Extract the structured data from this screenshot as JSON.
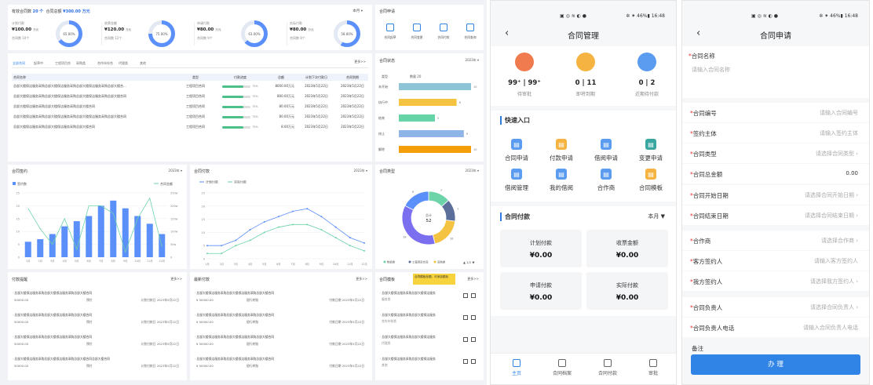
{
  "dashboard": {
    "summary": {
      "count_label": "有效合同数",
      "count_value": "20 个",
      "amount_label": "合同总额",
      "amount_value": "¥300.00 万元",
      "period": "本月",
      "kpis": [
        {
          "title": "计划付款",
          "value": "¥100.00",
          "unit": "万元",
          "sub": "合同数 10个",
          "pct": "65.00%",
          "pctnum": 65,
          "color": "#5b8ff9"
        },
        {
          "title": "收票金额",
          "value": "¥120.00",
          "unit": "万元",
          "sub": "合同数 12个",
          "pct": "75.00%",
          "pctnum": 75,
          "color": "#5b8ff9"
        },
        {
          "title": "申请付款",
          "value": "¥80.00",
          "unit": "万元",
          "sub": "合同数 9个",
          "pct": "63.00%",
          "pctnum": 63,
          "color": "#5b8ff9"
        },
        {
          "title": "实际付款",
          "value": "¥80.00",
          "unit": "万元",
          "sub": "合同数 8个",
          "pct": "58.00%",
          "pctnum": 58,
          "color": "#5b8ff9"
        }
      ]
    },
    "apply": {
      "title": "合同申请",
      "items": [
        "合同起草",
        "合同变更",
        "合同付款",
        "合同查询"
      ]
    },
    "contract_table": {
      "tabs": [
        "全部合同",
        "起草中",
        "工程项目合",
        "采购类",
        "合作伙伴合",
        "代理类",
        "其他"
      ],
      "more": "更多>>",
      "headers": [
        "合同名称",
        "类型",
        "付款进度",
        "总额",
        "计划下次付款日",
        "合同到期"
      ],
      "rows": [
        {
          "name": "总部大楼保洁服务采购总部大楼保洁服务采购总部大楼保洁服务采购总部大楼合...",
          "type": "工程项目合同",
          "pct": "75%",
          "fill": 75,
          "total": "8000.00万元",
          "next": "2023年5月22日",
          "due": "2023年5月22日"
        },
        {
          "name": "总部大楼保洁服务采购总部大楼保洁服务采购总部大楼保洁服务采购总部大楼合同",
          "type": "工程项目合同",
          "pct": "75%",
          "fill": 75,
          "total": "800.00万元",
          "next": "2023年5月22日",
          "due": "2023年5月22日"
        },
        {
          "name": "总部大楼保洁服务采购总部大楼保洁服务采购总部大楼合同",
          "type": "工程项目合同",
          "pct": "75%",
          "fill": 75,
          "total": "80.00万元",
          "next": "2023年5月22日",
          "due": "2023年5月22日"
        },
        {
          "name": "总部大楼保洁服务采购总部大楼保洁服务采购总部大楼保洁服务采购总部大楼合同",
          "type": "工程项目合同",
          "pct": "75%",
          "fill": 75,
          "total": "80.00万元",
          "next": "2023年5月22日",
          "due": "2023年5月22日"
        },
        {
          "name": "总部大楼保洁服务采购总部大楼保洁服务采购总部大楼合同",
          "type": "工程项目合同",
          "pct": "75%",
          "fill": 75,
          "total": "8.00万元",
          "next": "2023年5月22日",
          "due": "2023年5月22日"
        }
      ]
    },
    "status": {
      "title": "合同状态",
      "year": "2023年",
      "col1": "类型",
      "col2": "数量 20",
      "chart_data": {
        "type": "bar",
        "orientation": "horizontal",
        "categories": [
          "未开始",
          "执行中",
          "结束",
          "终止",
          "解除"
        ],
        "values": [
          10,
          8,
          5,
          9,
          10
        ],
        "colors": [
          "#8ec5d6",
          "#f5c342",
          "#66d4a6",
          "#8fb5e8",
          "#f59e0b"
        ],
        "xlim": [
          0,
          10
        ]
      }
    },
    "sign": {
      "title": "合同签约",
      "year": "2023年",
      "legend_a": "签约数",
      "legend_b": "合同金额",
      "chart_data": {
        "type": "bar+line",
        "categories": [
          "1月",
          "2月",
          "3月",
          "4月",
          "5月",
          "6月",
          "7月",
          "8月",
          "9月",
          "10月",
          "11月",
          "12月"
        ],
        "series": [
          {
            "name": "签约数",
            "values": [
              6,
              7,
              9,
              12,
              14,
              16,
              20,
              22,
              19,
              16,
              13,
              9
            ]
          },
          {
            "name": "合同金额",
            "values": [
              190,
              110,
              50,
              150,
              30,
              200,
              200,
              170,
              20,
              150,
              230,
              40
            ]
          }
        ],
        "ylim_left": [
          0,
          25
        ],
        "ylim_right": [
          0,
          250
        ],
        "yticks_left": [
          "0",
          "5",
          "10",
          "15",
          "20",
          "25"
        ],
        "yticks_right": [
          "0",
          "50w",
          "100w",
          "150w",
          "200w",
          "250w"
        ]
      }
    },
    "payment": {
      "title": "合同付款",
      "year": "2023年",
      "legend_a": "计划付款",
      "legend_b": "实际付款",
      "chart_data": {
        "type": "line",
        "categories": [
          "1月",
          "2月",
          "3月",
          "4月",
          "5月",
          "6月",
          "7月",
          "8月",
          "9月",
          "10月",
          "11月",
          "12月"
        ],
        "series": [
          {
            "name": "计划付款",
            "values": [
              5,
              5,
              7,
              11,
              14,
              16,
              18,
              19,
              16,
              12,
              8,
              6
            ]
          },
          {
            "name": "实际付款",
            "values": [
              2,
              2,
              5,
              7,
              10,
              12,
              13,
              13,
              11,
              8,
              5,
              3
            ]
          }
        ],
        "ylim": [
          0,
          25
        ],
        "yticks": [
          "0",
          "5",
          "10",
          "15",
          "20",
          "25"
        ]
      }
    },
    "types": {
      "title": "合同类型",
      "year": "2023年",
      "center_label": "总计",
      "center_value": "52",
      "chart_data": {
        "type": "pie",
        "labels": [
          "物资类",
          "工程项目合同",
          "采购类",
          "代理类",
          "其他"
        ],
        "values": [
          7,
          7,
          10,
          19,
          9
        ],
        "colors": [
          "#6dd3a8",
          "#5b6f9a",
          "#f5c342",
          "#7b6ff0",
          "#5b8ff9"
        ]
      },
      "legend": [
        "物资类",
        "工程项目合同",
        "采购类"
      ],
      "page": "1/2"
    },
    "reminder": {
      "title": "付款提醒",
      "more": "更多>>",
      "items": [
        {
          "name": "总部大楼保洁服务采购总部大楼保洁服务采购总部大楼合同",
          "amount": "50000.00",
          "tag": "预付",
          "date": "计划付款日 2023年5月22日"
        },
        {
          "name": "总部大楼保洁服务采购总部大楼保洁服务采购总部大楼合同",
          "amount": "50000.00",
          "tag": "预付",
          "date": "计划付款日 2023年5月22日"
        },
        {
          "name": "总部大楼保洁服务采购总部大楼保洁服务采购总部大楼合同",
          "amount": "50000.00",
          "tag": "预付",
          "date": "计划付款日 2023年5月22日"
        },
        {
          "name": "总部大楼保洁服务采购总部大楼保洁服务采购总部大楼合同总部大楼合同",
          "amount": "50000.00",
          "tag": "预付",
          "date": "计划付款日 2023年5月22日"
        }
      ]
    },
    "recent": {
      "title": "最新付款",
      "more": "更多>>",
      "items": [
        {
          "name": "总部大楼保洁服务采购总部大楼保洁服务采购总部大楼合同",
          "amount": "¥ 50000.00",
          "tag": "银行转账",
          "date": "付款日期 2023年5月22日"
        },
        {
          "name": "总部大楼保洁服务采购总部大楼保洁服务采购总部大楼合同",
          "amount": "¥ 50000.00",
          "tag": "银行转账",
          "date": "付款日期 2023年5月22日"
        },
        {
          "name": "总部大楼保洁服务采购总部大楼保洁服务采购总部大楼合同",
          "amount": "¥ 50000.00",
          "tag": "银行转账",
          "date": "付款日期 2023年5月22日"
        },
        {
          "name": "总部大楼保洁服务采购总部大楼保洁服务采购总部大楼合同",
          "amount": "¥ 50000.00",
          "tag": "银行转账",
          "date": "付款日期 2023年5月22日"
        }
      ]
    },
    "template": {
      "title": "合同模板",
      "more": "更多>>",
      "tooltip": "合同模板标题，可添加图标",
      "items": [
        {
          "name": "总部大楼保洁服务采购总部大楼保洁服务",
          "type": "服务类"
        },
        {
          "name": "总部大楼保洁服务采购总部大楼保洁服务",
          "type": "合作伙伴类"
        },
        {
          "name": "总部大楼保洁服务采购总部大楼保洁服务",
          "type": "代理类"
        },
        {
          "name": "总部大楼保洁服务采购总部大楼保洁服务",
          "type": "其他"
        }
      ]
    }
  },
  "mobile_mgmt": {
    "status_bar": {
      "icons": "▣ ◎ ≋ ◐ ●",
      "right": "✲ ⁕ 46%▮ 16:48"
    },
    "title": "合同管理",
    "stats": [
      {
        "value": "99⁺ | 99⁺",
        "label": "待审批",
        "color": "#f07b4f"
      },
      {
        "value": "0 | 11",
        "label": "即将到期",
        "color": "#f5b342"
      },
      {
        "value": "0 | 2",
        "label": "近期待付款",
        "color": "#5b9bf0"
      }
    ],
    "quick_title": "快速入口",
    "quick": [
      {
        "label": "合同申请",
        "color": "#5b9bf0"
      },
      {
        "label": "付款申请",
        "color": "#f5b342"
      },
      {
        "label": "借阅申请",
        "color": "#5b9bf0"
      },
      {
        "label": "变更申请",
        "color": "#3aa6a0"
      },
      {
        "label": "借阅管理",
        "color": "#5b9bf0"
      },
      {
        "label": "我的借阅",
        "color": "#5b9bf0"
      },
      {
        "label": "合作商",
        "color": "#5b9bf0"
      },
      {
        "label": "合同模板",
        "color": "#f5b342"
      }
    ],
    "pay_title": "合同付款",
    "pay_period": "本月",
    "pay": [
      {
        "label": "计划付款",
        "value": "¥0.00"
      },
      {
        "label": "收票金额",
        "value": "¥0.00"
      },
      {
        "label": "申请付款",
        "value": "¥0.00"
      },
      {
        "label": "实际付款",
        "value": "¥0.00"
      }
    ],
    "tabs": [
      "主页",
      "合同档案",
      "合同付款",
      "审批"
    ]
  },
  "mobile_apply": {
    "status_bar": {
      "icons": "▣ ◎ ≋ ◐ ●",
      "right": "✲ ⁕ 46%▮ 16:48"
    },
    "title": "合同申请",
    "name_label": "合同名称",
    "name_placeholder": "请输入合同名称",
    "fields": [
      {
        "label": "合同编号",
        "ph": "请输入合同编号",
        "arrow": ""
      },
      {
        "label": "签约主体",
        "ph": "请输入签约主体",
        "arrow": ""
      },
      {
        "label": "合同类型",
        "ph": "请选择合同类型",
        "arrow": "›"
      },
      {
        "label": "合同总金额",
        "ph": "0.00",
        "arrow": ""
      },
      {
        "label": "合同开始日期",
        "ph": "请选择合同开始日期",
        "arrow": "›"
      },
      {
        "label": "合同结束日期",
        "ph": "请选择合同结束日期",
        "arrow": "›"
      },
      {
        "label": "合作商",
        "ph": "请选择合作商",
        "arrow": "›"
      },
      {
        "label": "客方签约人",
        "ph": "请输入客方签约人",
        "arrow": ""
      },
      {
        "label": "我方签约人",
        "ph": "请选择我方签约人",
        "arrow": "›"
      },
      {
        "label": "合同负责人",
        "ph": "请选择合同负责人",
        "arrow": "›"
      },
      {
        "label": "合同负责人电话",
        "ph": "请输入合同负责人电话",
        "arrow": ""
      }
    ],
    "remark_label": "备注",
    "submit": "办 理"
  }
}
